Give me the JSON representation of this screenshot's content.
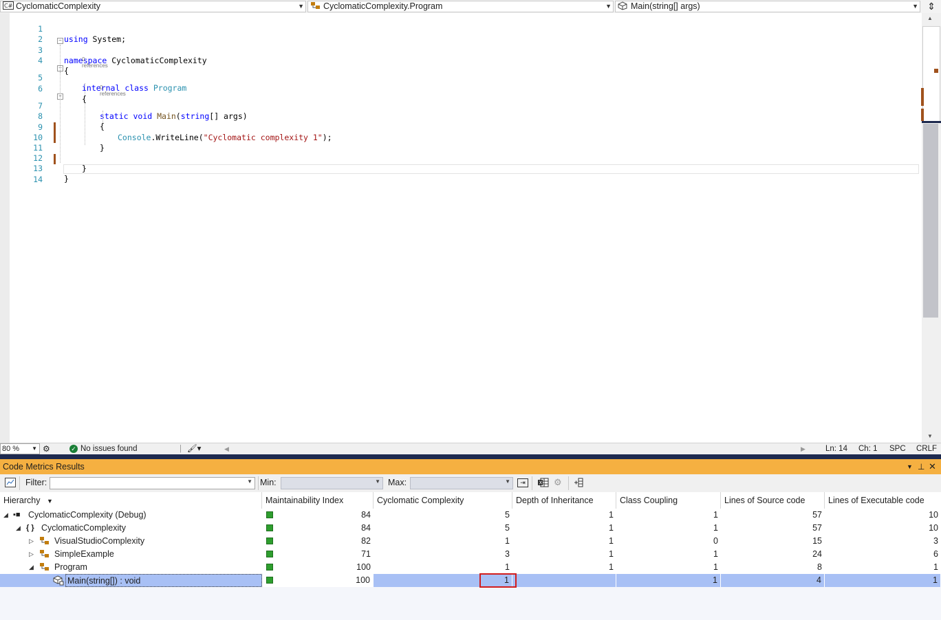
{
  "nav": {
    "project": "CyclomaticComplexity",
    "class": "CyclomaticComplexity.Program",
    "member": "Main(string[] args)"
  },
  "code": {
    "lines": [
      {
        "n": "1"
      },
      {
        "n": "2"
      },
      {
        "n": "3"
      },
      {
        "n": "4"
      },
      {
        "n": "5"
      },
      {
        "n": "6"
      },
      {
        "n": "7"
      },
      {
        "n": "8"
      },
      {
        "n": "9"
      },
      {
        "n": "10"
      },
      {
        "n": "11"
      },
      {
        "n": "12"
      },
      {
        "n": "13"
      },
      {
        "n": "14"
      }
    ],
    "tokens": {
      "using": "using",
      "system": " System;",
      "namespace": "namespace",
      "ns_name": " CyclomaticComplexity",
      "open_brace": "{",
      "close_brace": "}",
      "internal": "internal",
      "class_kw": " class",
      "program": " Program",
      "static": "static",
      "void": " void",
      "main": " Main",
      "paren_open": "(",
      "string_kw": "string",
      "args": "[] args)",
      "console": "Console",
      "writeline": ".WriteLine(",
      "str_literal": "\"Cyclomatic complexity 1\"",
      "end_call": ");"
    },
    "refs1": "0 references",
    "refs2": "0 references"
  },
  "status": {
    "zoom": "80 %",
    "issues": "No issues found",
    "ln": "Ln: 14",
    "ch": "Ch: 1",
    "spc": "SPC",
    "crlf": "CRLF"
  },
  "toolwindow": {
    "title": "Code Metrics Results",
    "filter_label": "Filter:",
    "min_label": "Min:",
    "max_label": "Max:"
  },
  "table": {
    "headers": [
      "Hierarchy",
      "Maintainability Index",
      "Cyclomatic Complexity",
      "Depth of Inheritance",
      "Class Coupling",
      "Lines of Source code",
      "Lines of Executable code"
    ],
    "rows": [
      {
        "name": "CyclomaticComplexity (Debug)",
        "mi": "84",
        "cc": "5",
        "doi": "1",
        "cpl": "1",
        "los": "57",
        "loe": "10"
      },
      {
        "name": "CyclomaticComplexity",
        "mi": "84",
        "cc": "5",
        "doi": "1",
        "cpl": "1",
        "los": "57",
        "loe": "10"
      },
      {
        "name": "VisualStudioComplexity",
        "mi": "82",
        "cc": "1",
        "doi": "1",
        "cpl": "0",
        "los": "15",
        "loe": "3"
      },
      {
        "name": "SimpleExample",
        "mi": "71",
        "cc": "3",
        "doi": "1",
        "cpl": "1",
        "los": "24",
        "loe": "6"
      },
      {
        "name": "Program",
        "mi": "100",
        "cc": "1",
        "doi": "1",
        "cpl": "1",
        "los": "8",
        "loe": "1"
      },
      {
        "name": "Main(string[]) : void",
        "mi": "100",
        "cc": "1",
        "doi": "",
        "cpl": "1",
        "los": "4",
        "loe": "1"
      }
    ]
  },
  "colors": {
    "tool_title": "#f5b041",
    "selection": "#a8c0f5",
    "highlight_box": "#d21d1d",
    "mi_good": "#2e9e2e"
  },
  "icons": [
    "csharp-file-icon",
    "class-icon",
    "method-icon",
    "solution-icon",
    "namespace-icon",
    "check-circle-icon"
  ]
}
